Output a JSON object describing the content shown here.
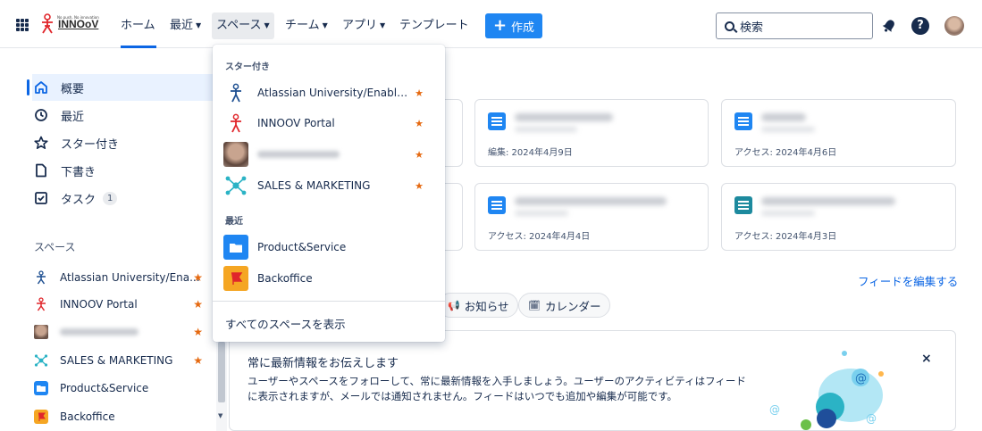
{
  "topnav": {
    "logo": "INNOoV",
    "logo_sub": "No push, No innovation",
    "items": [
      {
        "label": "ホーム"
      },
      {
        "label": "最近"
      },
      {
        "label": "スペース"
      },
      {
        "label": "チーム"
      },
      {
        "label": "アプリ"
      },
      {
        "label": "テンプレート"
      }
    ],
    "create_label": "作成",
    "search_placeholder": "検索"
  },
  "sidebar": {
    "items": [
      {
        "label": "概要",
        "icon": "home-icon"
      },
      {
        "label": "最近",
        "icon": "clock-icon"
      },
      {
        "label": "スター付き",
        "icon": "star-outline-icon"
      },
      {
        "label": "下書き",
        "icon": "draft-icon"
      },
      {
        "label": "タスク",
        "icon": "task-icon",
        "badge": "1"
      }
    ],
    "spaces_heading": "スペース",
    "spaces": [
      {
        "label": "Atlassian University/Ena...",
        "starred": true,
        "icon": "atlassian-university-icon"
      },
      {
        "label": "INNOOV Portal",
        "starred": true,
        "icon": "innoov-portal-icon"
      },
      {
        "label": "",
        "starred": true,
        "icon": "person-avatar"
      },
      {
        "label": "SALES & MARKETING",
        "starred": true,
        "icon": "network-icon"
      },
      {
        "label": "Product&Service",
        "starred": false,
        "icon": "folder-icon"
      },
      {
        "label": "Backoffice",
        "starred": false,
        "icon": "flag-icon"
      }
    ]
  },
  "cards": [
    {
      "meta": "編集: 2024年4月9日",
      "icon": "doc-icon"
    },
    {
      "meta": "アクセス: 2024年4月6日",
      "icon": "doc-icon"
    },
    {
      "meta": "アクセス: 2024年4月4日",
      "icon": "doc-icon"
    },
    {
      "meta": "アクセス: 2024年4月3日",
      "icon": "whiteboard-icon"
    }
  ],
  "feed": {
    "edit_label": "フィードを編集する",
    "chips": [
      {
        "label": "お知らせ",
        "icon": "megaphone-icon"
      },
      {
        "label": "カレンダー",
        "icon": "calendar-icon"
      }
    ],
    "info_title": "常に最新情報をお伝えします",
    "info_body": "ユーザーやスペースをフォローして、常に最新情報を入手しましょう。ユーザーのアクティビティはフィードに表示されますが、メールでは通知されません。フィードはいつでも追加や編集が可能です。",
    "close": "×"
  },
  "dropdown": {
    "starred_heading": "スター付き",
    "starred": [
      {
        "label": "Atlassian University/Enableme...",
        "icon": "atlassian-university-icon"
      },
      {
        "label": "INNOOV Portal",
        "icon": "innoov-portal-icon"
      },
      {
        "label": "",
        "icon": "person-avatar"
      },
      {
        "label": "SALES & MARKETING",
        "icon": "network-icon"
      }
    ],
    "recent_heading": "最近",
    "recent": [
      {
        "label": "Product&Service",
        "icon": "folder-icon"
      },
      {
        "label": "Backoffice",
        "icon": "flag-icon"
      }
    ],
    "view_all": "すべてのスペースを表示"
  },
  "colors": {
    "accent": "#0c66e4",
    "create": "#1f86f2",
    "star": "#e56910",
    "logo_red": "#e0262b",
    "network": "#2bb3c5"
  }
}
